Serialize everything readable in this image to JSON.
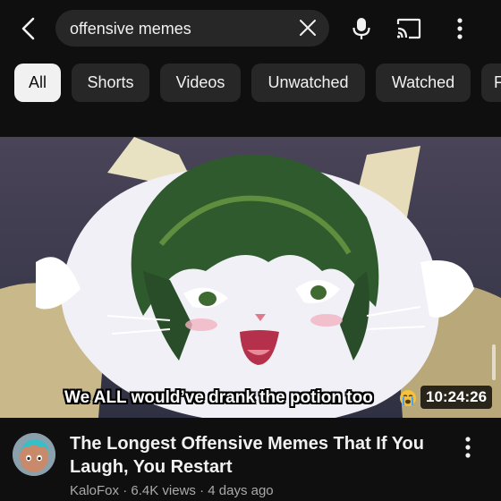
{
  "search": {
    "query": "offensive memes"
  },
  "filters": {
    "chips": [
      "All",
      "Shorts",
      "Videos",
      "Unwatched",
      "Watched",
      "F"
    ],
    "active": "All"
  },
  "icons": {
    "back": "chevron-left-icon",
    "clear": "close-icon",
    "mic": "microphone-icon",
    "cast": "cast-icon",
    "more": "more-vertical-icon"
  },
  "video": {
    "caption": "We ALL would’ve drank the potion too",
    "duration": "10:24:26",
    "title": "The Longest Offensive Memes That If You Laugh, You Restart",
    "channel": "KaloFox",
    "views": "6.4K views",
    "age": "4 days ago",
    "separator": " · "
  },
  "colors": {
    "background": "#0f0f0f",
    "chip": "#272727",
    "chip_active": "#f1f1f1",
    "secondary_text": "#aaaaaa"
  }
}
